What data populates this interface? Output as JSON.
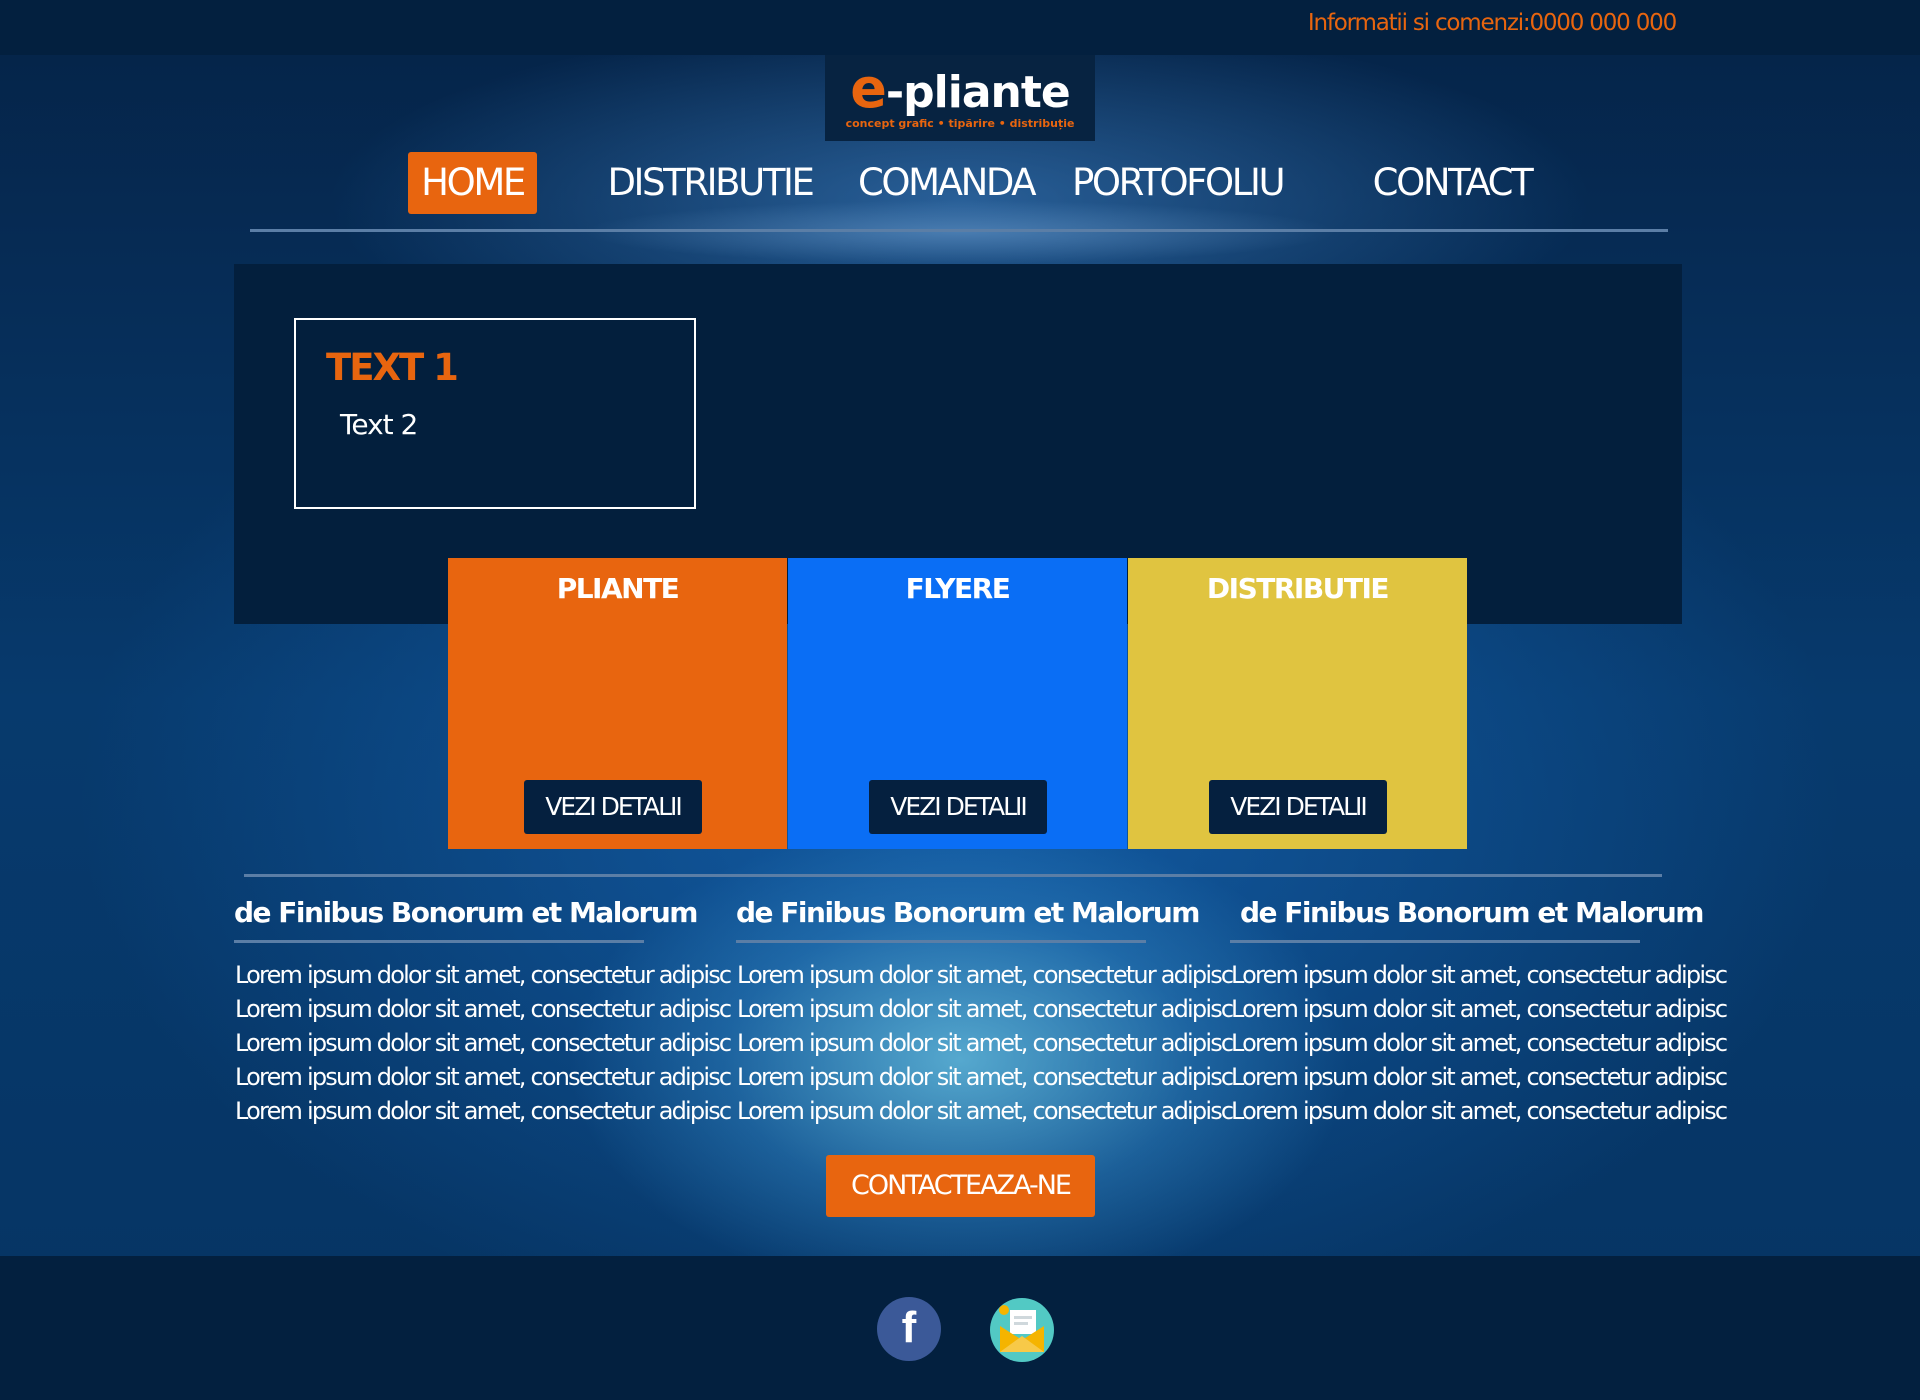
{
  "topbar": {
    "info": "Informatii si comenzi:0000 000 000"
  },
  "logo": {
    "e": "e",
    "rest": "-pliante",
    "tagline": "concept grafic  •  tipărire  •  distribuție"
  },
  "nav": [
    {
      "label": "HOME",
      "active": true
    },
    {
      "label": "DISTRIBUTIE"
    },
    {
      "label": "COMANDA"
    },
    {
      "label": "PORTOFOLIU"
    },
    {
      "label": "CONTACT"
    }
  ],
  "hero": {
    "title": "TEXT 1",
    "subtitle": "Text 2"
  },
  "cards": [
    {
      "title": "PLIANTE",
      "button": "VEZI DETALII",
      "color": "#e8650f"
    },
    {
      "title": "FLYERE",
      "button": "VEZI DETALII",
      "color": "#0a6ef5"
    },
    {
      "title": "DISTRIBUTIE",
      "button": "VEZI DETALII",
      "color": "#e0c440"
    }
  ],
  "columns": [
    {
      "heading": "de Finibus Bonorum et Malorum",
      "lines": [
        "Lorem ipsum dolor sit amet, consectetur adipisc",
        "Lorem ipsum dolor sit amet, consectetur adipisc",
        "Lorem ipsum dolor sit amet, consectetur adipisc",
        "Lorem ipsum dolor sit amet, consectetur adipisc",
        "Lorem ipsum dolor sit amet, consectetur adipisc"
      ]
    },
    {
      "heading": "de Finibus Bonorum et Malorum",
      "lines": [
        "Lorem ipsum dolor sit amet, consectetur adipisc",
        "Lorem ipsum dolor sit amet, consectetur adipisc",
        "Lorem ipsum dolor sit amet, consectetur adipisc",
        "Lorem ipsum dolor sit amet, consectetur adipisc",
        "Lorem ipsum dolor sit amet, consectetur adipisc"
      ]
    },
    {
      "heading": "de Finibus Bonorum et Malorum",
      "lines": [
        "Lorem ipsum dolor sit amet, consectetur adipisc",
        "Lorem ipsum dolor sit amet, consectetur adipisc",
        "Lorem ipsum dolor sit amet, consectetur adipisc",
        "Lorem ipsum dolor sit amet, consectetur adipisc",
        "Lorem ipsum dolor sit amet, consectetur adipisc"
      ]
    }
  ],
  "cta": {
    "label": "CONTACTEAZA-NE"
  },
  "footer": {
    "facebook_icon": "facebook-icon",
    "facebook_letter": "f",
    "mail_icon": "mail-icon"
  },
  "colors": {
    "accent": "#e8650f",
    "dark": "#03203f"
  }
}
